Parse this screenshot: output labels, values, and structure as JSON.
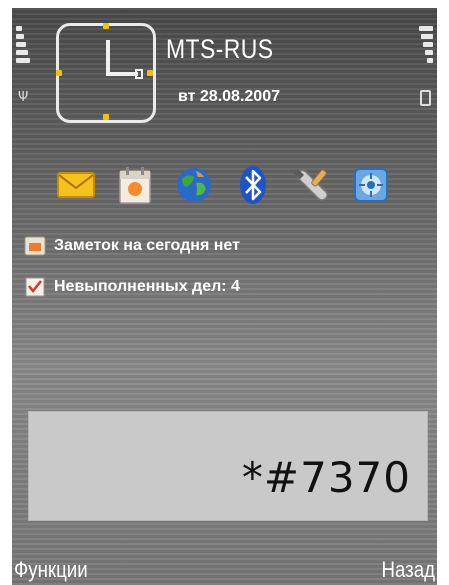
{
  "status": {
    "operator": "MTS-RUS",
    "date": "вт 28.08.2007"
  },
  "shortcuts": [
    {
      "icon": "messaging-icon"
    },
    {
      "icon": "calendar-icon"
    },
    {
      "icon": "web-globe-icon"
    },
    {
      "icon": "bluetooth-icon"
    },
    {
      "icon": "settings-wrench-icon"
    },
    {
      "icon": "connectivity-icon"
    }
  ],
  "info": {
    "notes": "Заметок на сегодня нет",
    "todos": "Невыполненных дел: 4"
  },
  "entry": {
    "value": "*#7370"
  },
  "softkeys": {
    "left": "Функции",
    "right": "Назад"
  },
  "colors": {
    "clock_accent": "#f2c200",
    "entry_background": "#c9c9c9"
  }
}
